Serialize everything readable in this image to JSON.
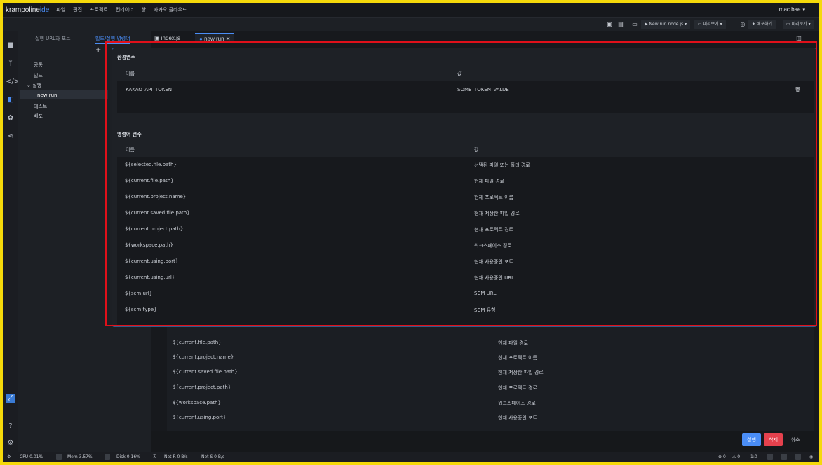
{
  "app": {
    "logo_main": "krampoline",
    "logo_ide": "ide",
    "user": "mac.bae"
  },
  "menu": [
    "파일",
    "편집",
    "프로젝트",
    "컨테이너",
    "창",
    "카카오 클라우드"
  ],
  "toolbar": {
    "run_config": "New run node.js",
    "preview1": "미리보기",
    "deploy": "배포하기",
    "preview2": "미리보기"
  },
  "sidepanel": {
    "tabs": [
      "실행 URL과 포트",
      "빌드/실행 명령어"
    ],
    "tree": [
      "공통",
      "빌드",
      "실행",
      "new run",
      "테스트",
      "배포"
    ]
  },
  "editor": {
    "tabs": [
      "index.js",
      "new run"
    ]
  },
  "modal": {
    "env_title": "환경변수",
    "env_headers": [
      "이름",
      "값"
    ],
    "env_row": {
      "name": "KAKAO_API_TOKEN",
      "value": "SOME_TOKEN_VALUE"
    },
    "cmd_title": "명령어 변수",
    "cmd_headers": [
      "이름",
      "값"
    ],
    "cmd_rows": [
      {
        "k": "${selected.file.path}",
        "v": "선택된 파일 또는 폴더 경로"
      },
      {
        "k": "${current.file.path}",
        "v": "현재 파일 경로"
      },
      {
        "k": "${current.project.name}",
        "v": "현재 프로젝트 이름"
      },
      {
        "k": "${current.saved.file.path}",
        "v": "현재 저장한 파일 경로"
      },
      {
        "k": "${current.project.path}",
        "v": "현재 프로젝트 경로"
      },
      {
        "k": "${workspace.path}",
        "v": "워크스페이스 경로"
      },
      {
        "k": "${current.using.port}",
        "v": "현재 사용중인 포트"
      },
      {
        "k": "${current.using.url}",
        "v": "현재 사용중인 URL"
      },
      {
        "k": "${scm.url}",
        "v": "SCM URL"
      },
      {
        "k": "${scm.type}",
        "v": "SCM 유형"
      }
    ]
  },
  "background_rows": [
    {
      "k": "${current.file.path}",
      "v": "현재 파일 경로"
    },
    {
      "k": "${current.project.name}",
      "v": "현재 프로젝트 이름"
    },
    {
      "k": "${current.saved.file.path}",
      "v": "현재 저장한 파일 경로"
    },
    {
      "k": "${current.project.path}",
      "v": "현재 프로젝트 경로"
    },
    {
      "k": "${workspace.path}",
      "v": "워크스페이스 경로"
    },
    {
      "k": "${current.using.port}",
      "v": "현재 사용중인 포트"
    }
  ],
  "buttons": {
    "run": "실행",
    "delete": "삭제",
    "cancel": "취소"
  },
  "status": {
    "cpu": "CPU 0.01%",
    "mem": "Mem 3.57%",
    "disk": "Disk 0.16%",
    "net_r": "Net R 0 B/s",
    "net_s": "Net S 0 B/s",
    "err": "0",
    "warn": "0",
    "pos": "1:0"
  },
  "colors": {
    "accent": "#4a8df6",
    "danger": "#e5414d",
    "highlight": "#e0101a"
  }
}
